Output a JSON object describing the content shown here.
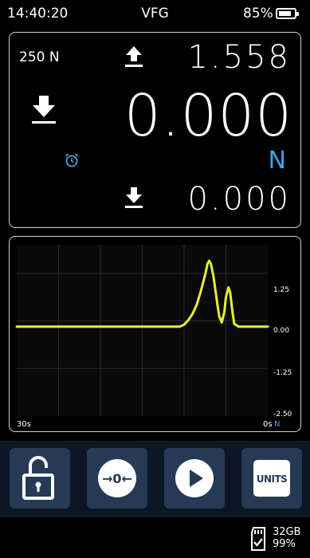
{
  "status": {
    "time": "14:40:20",
    "title": "VFG",
    "battery_pct": "85%",
    "battery_level": 0.85
  },
  "readout": {
    "capacity": "250 N",
    "max_value": "1.558",
    "main_value": "0.000",
    "unit": "N",
    "min_value": "0.000"
  },
  "chart": {
    "x_start_label": "30s",
    "x_end_label": "0s",
    "unit_label": "N",
    "y_ticks": [
      "1.25",
      "0.00",
      "-1.25",
      "-2.50"
    ]
  },
  "chart_data": {
    "type": "line",
    "xlabel": "",
    "ylabel": "",
    "x_range": [
      30,
      0
    ],
    "ylim": [
      -2.5,
      2.0
    ],
    "grid": true,
    "series": [
      {
        "color": "#e6f02e",
        "x": [
          30,
          25,
          20,
          15,
          10.5,
          10,
          9.5,
          9,
          8.5,
          8,
          7.5,
          7.2,
          7,
          6.8,
          6.5,
          6.2,
          6,
          5.8,
          5.5,
          5.2,
          5,
          4.7,
          4.5,
          4.2,
          4,
          3.5,
          3,
          2,
          1,
          0
        ],
        "y": [
          -0.15,
          -0.15,
          -0.15,
          -0.15,
          -0.15,
          -0.1,
          0.02,
          0.18,
          0.42,
          0.78,
          1.2,
          1.5,
          1.58,
          1.5,
          1.18,
          0.72,
          0.4,
          0.12,
          -0.04,
          0.22,
          0.62,
          0.88,
          0.75,
          0.2,
          -0.08,
          -0.15,
          -0.15,
          -0.15,
          -0.15,
          -0.15
        ]
      }
    ]
  },
  "buttons": {
    "zero_label": "→0←",
    "units_label": "UNITS"
  },
  "storage": {
    "size": "32GB",
    "free_pct": "99%"
  },
  "colors": {
    "accent_blue": "#3aa6e8",
    "trace": "#e6f02e",
    "button_bg": "#263a55",
    "button_bar_bg": "#0c1624"
  },
  "icons": {
    "max": "arrow-up-icon",
    "track": "arrow-down-icon",
    "alarm": "alarm-clock-icon",
    "min": "arrow-down-icon",
    "lock": "unlock-icon",
    "play": "play-icon",
    "sd": "sd-card-icon"
  }
}
